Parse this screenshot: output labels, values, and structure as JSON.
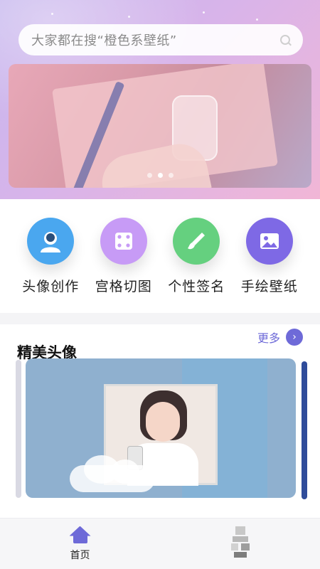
{
  "search": {
    "placeholder": "大家都在搜“橙色系壁纸”"
  },
  "banner": {
    "page_indicators": 3,
    "active_index": 1
  },
  "quick_actions": [
    {
      "label": "头像创作",
      "icon": "avatar-icon",
      "color": "#4aa7ef"
    },
    {
      "label": "宫格切图",
      "icon": "grid-dice-icon",
      "color": "#c79bf6"
    },
    {
      "label": "个性签名",
      "icon": "brush-icon",
      "color": "#65d07f"
    },
    {
      "label": "手绘壁纸",
      "icon": "picture-icon",
      "color": "#7e69e5"
    }
  ],
  "section": {
    "title": "精美头像",
    "more_label": "更多",
    "more_icon": "chevron-right-icon"
  },
  "tabbar": [
    {
      "label": "首页",
      "icon": "home-icon",
      "active": true
    },
    {
      "label": "",
      "icon": "profile-icon",
      "active": false
    }
  ],
  "colors": {
    "accent": "#6e6ad8"
  }
}
